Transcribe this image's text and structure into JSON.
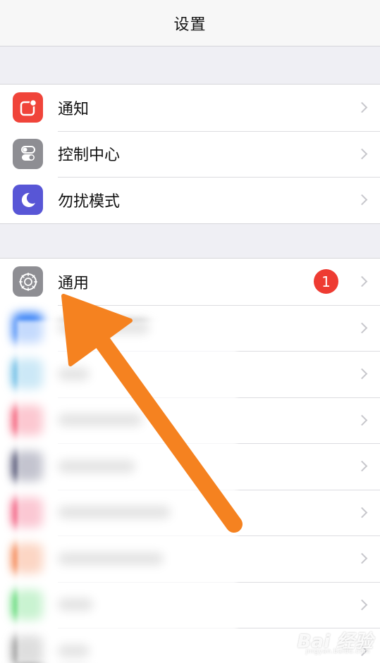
{
  "navbar": {
    "title": "设置"
  },
  "group1": {
    "items": [
      {
        "label": "通知",
        "icon": "notifications-icon",
        "color": "#f0443a"
      },
      {
        "label": "控制中心",
        "icon": "control-center-icon",
        "color": "#8e8e93"
      },
      {
        "label": "勿扰模式",
        "icon": "moon-icon",
        "color": "#5856d6"
      }
    ]
  },
  "group2": {
    "items": [
      {
        "label": "通用",
        "icon": "gear-icon",
        "color": "#8e8e93",
        "badge": "1"
      }
    ],
    "blurred_icon_colors": [
      "#2f7cf6",
      "#49aee0",
      "#f23a5a",
      "#2b2d54",
      "#f03a63",
      "#f26b2d",
      "#3fd25a",
      "#8a8a8a"
    ]
  },
  "watermark": {
    "brand": "Bai 经验",
    "site": "jingyan.baidu.com"
  },
  "colors": {
    "arrow": "#f58220",
    "badge": "#ee3b32"
  }
}
